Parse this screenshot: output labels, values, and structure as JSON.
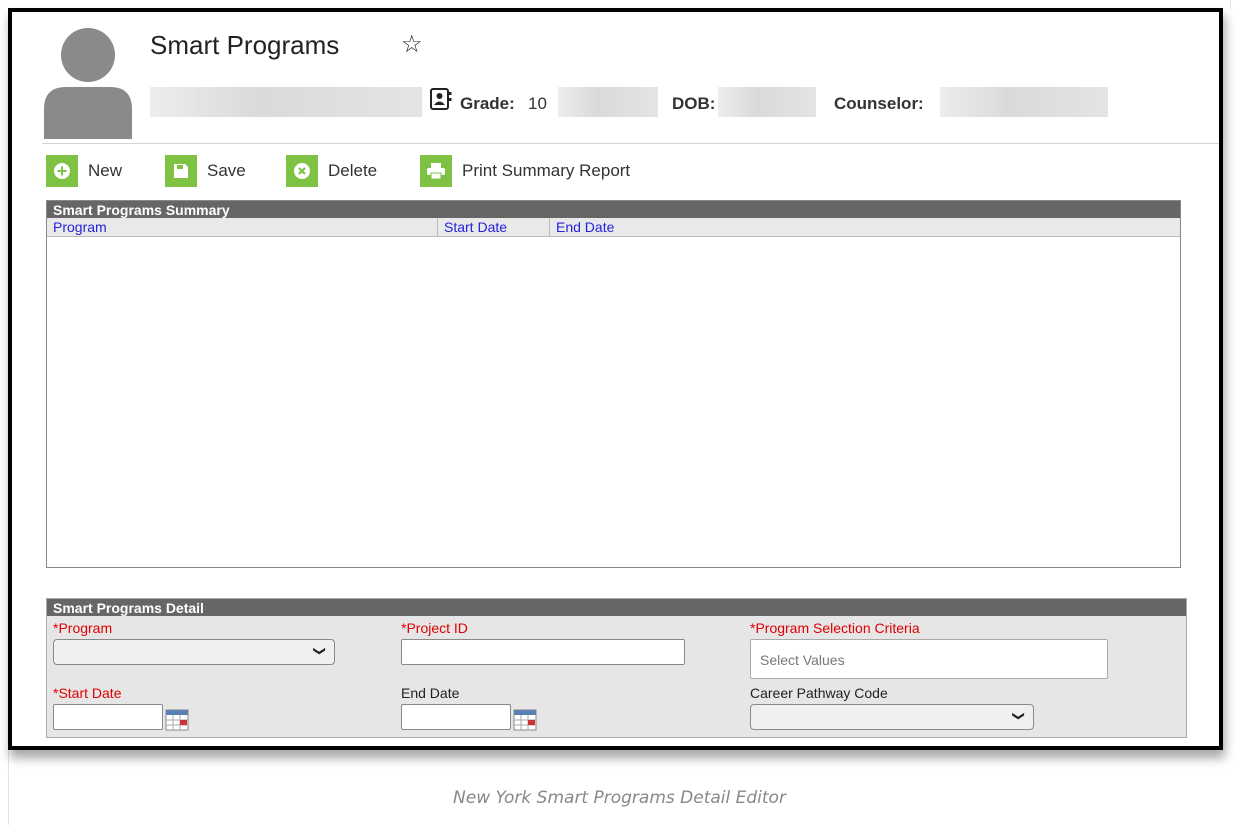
{
  "page": {
    "title": "Smart Programs",
    "caption": "New York Smart Programs Detail Editor"
  },
  "header": {
    "grade_label": "Grade:",
    "grade_value": "10",
    "dob_label": "DOB:",
    "counselor_label": "Counselor:"
  },
  "toolbar": {
    "new_label": "New",
    "save_label": "Save",
    "delete_label": "Delete",
    "print_label": "Print Summary Report",
    "icon_color": "#7dc242"
  },
  "summary": {
    "title": "Smart Programs Summary",
    "columns": [
      "Program",
      "Start Date",
      "End Date"
    ],
    "rows": []
  },
  "detail": {
    "title": "Smart Programs Detail",
    "program_label": "*Program",
    "project_id_label": "*Project ID",
    "selection_criteria_label": "*Program Selection Criteria",
    "selection_criteria_placeholder": "Select Values",
    "start_date_label": "*Start Date",
    "end_date_label": "End Date",
    "career_pathway_label": "Career Pathway Code"
  },
  "colors": {
    "required": "#e00000",
    "column_header_text": "#2222dd",
    "section_header_bg": "#666666"
  }
}
